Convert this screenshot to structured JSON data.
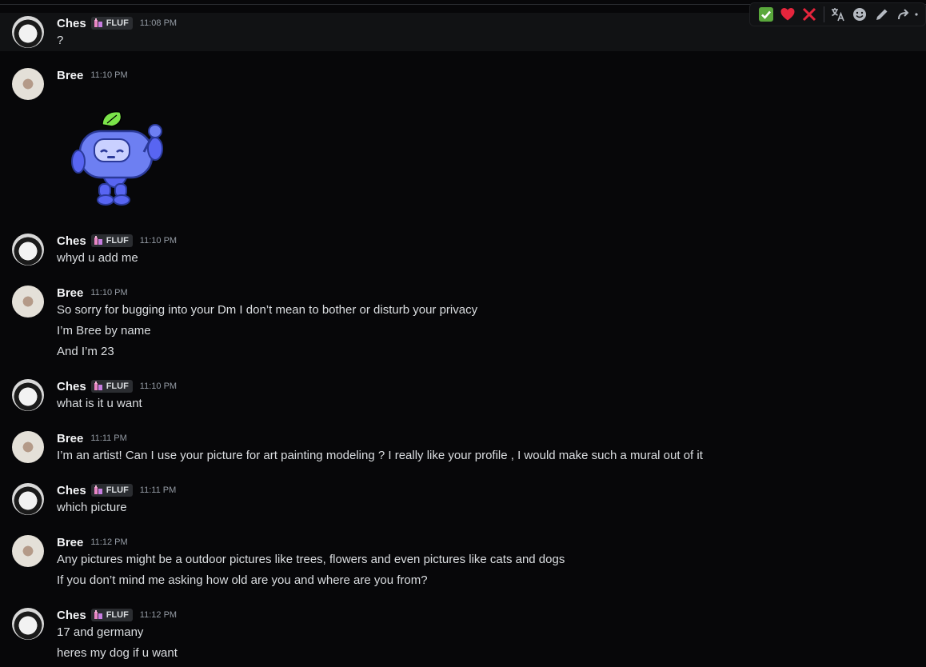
{
  "toolbar": {
    "reactions": [
      "check-mark-reaction",
      "heart-reaction",
      "cross-mark-reaction"
    ],
    "actions": [
      "translate-icon",
      "add-reaction-icon",
      "edit-icon",
      "forward-icon",
      "more-icon"
    ]
  },
  "messages": [
    {
      "user": "Ches",
      "tag": "FLUF",
      "time": "11:08 PM",
      "lines": [
        "?"
      ]
    },
    {
      "user": "Bree",
      "time": "11:10 PM",
      "lines": []
    },
    {
      "user": "Ches",
      "tag": "FLUF",
      "time": "11:10 PM",
      "lines": [
        "whyd u add me"
      ]
    },
    {
      "user": "Bree",
      "time": "11:10 PM",
      "lines": [
        "So sorry for bugging into your Dm I don’t mean to bother or disturb your privacy",
        "I’m Bree by name",
        "And I’m 23"
      ]
    },
    {
      "user": "Ches",
      "tag": "FLUF",
      "time": "11:10 PM",
      "lines": [
        "what is it u want"
      ]
    },
    {
      "user": "Bree",
      "time": "11:11 PM",
      "lines": [
        "I’m an artist! Can I use your picture for art painting modeling ? I really like your profile , I would make such a mural out of it"
      ]
    },
    {
      "user": "Ches",
      "tag": "FLUF",
      "time": "11:11 PM",
      "lines": [
        "which picture"
      ]
    },
    {
      "user": "Bree",
      "time": "11:12 PM",
      "lines": [
        "Any pictures might be a outdoor pictures like trees, flowers and even pictures like cats and dogs",
        "If you don’t mind me asking how old are you and where are you from?"
      ]
    },
    {
      "user": "Ches",
      "tag": "FLUF",
      "time": "11:12 PM",
      "lines": [
        "17 and germany",
        "heres my dog if u want"
      ]
    }
  ],
  "colors": {
    "background": "#070709",
    "hover": "#111214",
    "text": "#dbdee1",
    "timestamp": "#949ba4",
    "sticker": "#5865f2",
    "leaf": "#57f287"
  }
}
